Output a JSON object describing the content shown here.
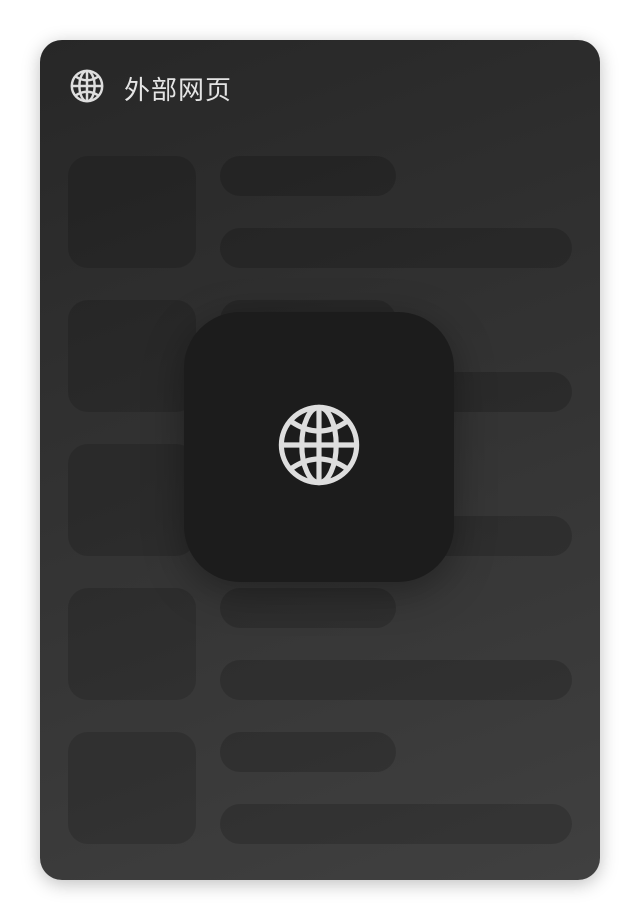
{
  "header": {
    "title": "外部网页",
    "icon": "globe-icon"
  },
  "overlay": {
    "icon": "globe-icon"
  },
  "skeleton_rows": 5,
  "colors": {
    "icon": "#dedede",
    "overlay_bg": "#1c1c1c"
  }
}
